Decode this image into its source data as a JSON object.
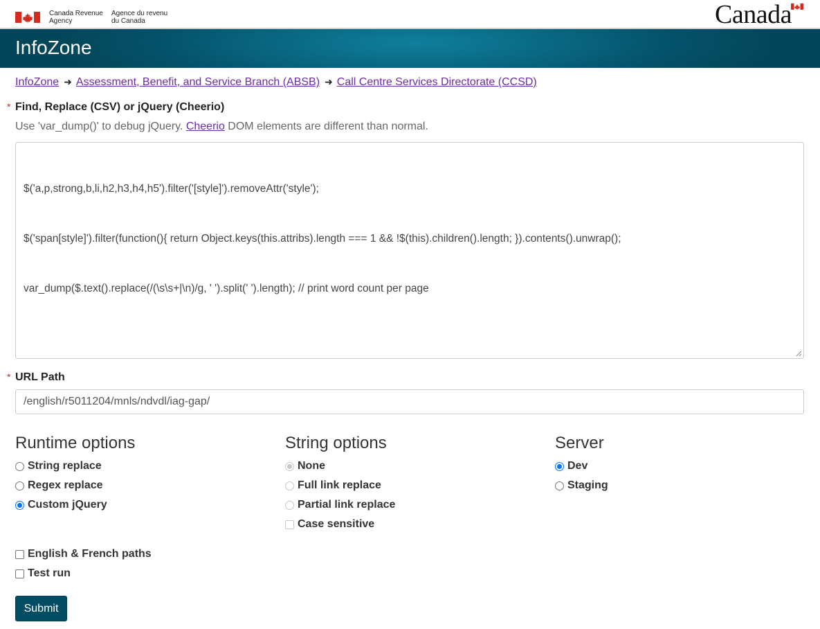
{
  "gov_header": {
    "agency_en": "Canada Revenue\nAgency",
    "agency_fr": "Agence du revenu\ndu Canada",
    "wordmark": "Canada"
  },
  "banner": {
    "title": "InfoZone"
  },
  "breadcrumb": {
    "items": [
      "InfoZone",
      "Assessment, Benefit, and Service Branch (ABSB)",
      "Call Centre Services Directorate (CCSD)"
    ],
    "separator": "➜"
  },
  "form": {
    "required_mark": "*",
    "find_replace": {
      "label": "Find, Replace (CSV) or jQuery (Cheerio)",
      "hint_before": "Use 'var_dump()' to debug jQuery. ",
      "hint_link": "Cheerio",
      "hint_after": " DOM elements are different than normal.",
      "code_lines": [
        "$('a,p,strong,b,li,h2,h3,h4,h5').filter('[style]').removeAttr('style');",
        "$('span[style]').filter(function(){ return Object.keys(this.attribs).length === 1 && !$(this).children().length; }).contents().unwrap();",
        "var_dump($.text().replace(/(\\s\\s+|\\n)/g, ' ').split(' ').length); // print word count per page"
      ]
    },
    "url_path": {
      "label": "URL Path",
      "value": "/english/r5011204/mnls/ndvdl/iag-gap/"
    },
    "runtime_options": {
      "title": "Runtime options",
      "options": [
        {
          "label": "String replace",
          "checked": false
        },
        {
          "label": "Regex replace",
          "checked": false
        },
        {
          "label": "Custom jQuery",
          "checked": true
        }
      ]
    },
    "string_options": {
      "title": "String options",
      "radios": [
        {
          "label": "None",
          "checked": true,
          "disabled": true
        },
        {
          "label": "Full link replace",
          "checked": false,
          "disabled": true
        },
        {
          "label": "Partial link replace",
          "checked": false,
          "disabled": true
        }
      ],
      "checkbox": {
        "label": "Case sensitive",
        "checked": false,
        "disabled": true
      }
    },
    "server": {
      "title": "Server",
      "options": [
        {
          "label": "Dev",
          "checked": true
        },
        {
          "label": "Staging",
          "checked": false
        }
      ]
    },
    "extra_checkboxes": [
      {
        "label": "English & French paths",
        "checked": false
      },
      {
        "label": "Test run",
        "checked": false
      }
    ],
    "submit_label": "Submit"
  },
  "colors": {
    "banner": "#045068",
    "link": "#6e2aa6",
    "required": "#c0282d",
    "radio_checked": "#0075ff",
    "submit_bg": "#024d63"
  }
}
